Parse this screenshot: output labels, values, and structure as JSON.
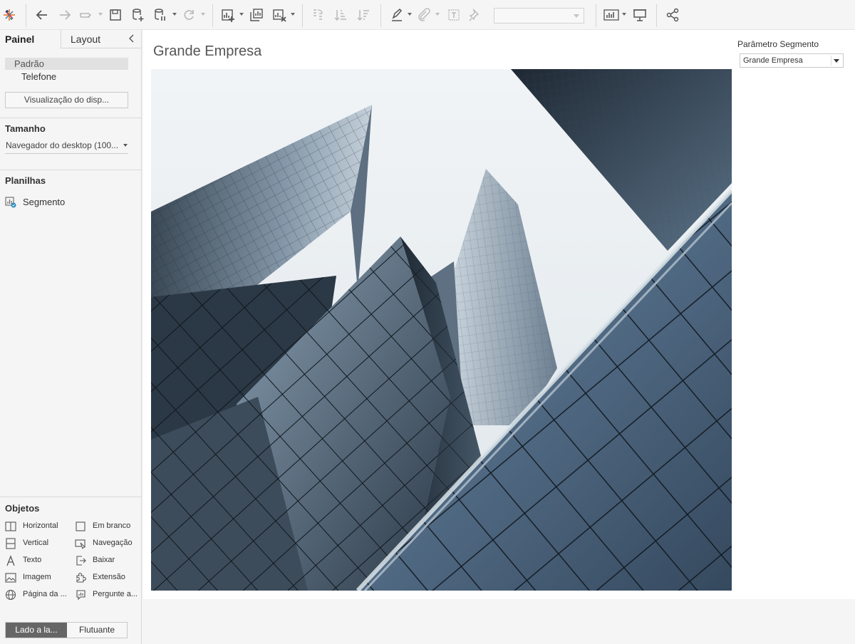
{
  "toolbar": {
    "icons": [
      "tableau-logo-icon",
      "undo-icon",
      "redo-icon",
      "replay-icon",
      "save-icon",
      "new-datasource-icon",
      "pause-updates-icon",
      "refresh-icon",
      "new-worksheet-icon",
      "duplicate-sheet-icon",
      "clear-sheet-icon",
      "swap-icon",
      "sort-ascending-icon",
      "sort-descending-icon",
      "highlight-icon",
      "group-icon",
      "labels-icon",
      "fix-axes-icon",
      "show-me-icon",
      "presentation-icon",
      "share-icon"
    ],
    "fit_dropdown_value": ""
  },
  "left_panel": {
    "tab_dashboard": "Painel",
    "tab_layout": "Layout",
    "devices": {
      "default": "Padrão",
      "phone": "Telefone"
    },
    "device_preview_button": "Visualização do disp...",
    "size": {
      "title": "Tamanho",
      "value": "Navegador do desktop (100..."
    },
    "sheets": {
      "title": "Planilhas",
      "items": [
        "Segmento"
      ]
    },
    "objects": {
      "title": "Objetos",
      "items": [
        {
          "label": "Horizontal",
          "icon": "horizontal-container-icon"
        },
        {
          "label": "Em branco",
          "icon": "blank-icon"
        },
        {
          "label": "Vertical",
          "icon": "vertical-container-icon"
        },
        {
          "label": "Navegação",
          "icon": "navigation-icon"
        },
        {
          "label": "Texto",
          "icon": "text-icon"
        },
        {
          "label": "Baixar",
          "icon": "download-icon"
        },
        {
          "label": "Imagem",
          "icon": "image-icon"
        },
        {
          "label": "Extensão",
          "icon": "extension-icon"
        },
        {
          "label": "Página da ...",
          "icon": "web-page-icon"
        },
        {
          "label": "Pergunte a...",
          "icon": "ask-data-icon"
        }
      ]
    },
    "layout_mode": {
      "tiled": "Lado a la...",
      "floating": "Flutuante"
    }
  },
  "dashboard": {
    "title": "Grande Empresa",
    "image_description_icon": "skyscrapers-image",
    "parameter": {
      "label": "Parâmetro Segmento",
      "value": "Grande Empresa"
    }
  },
  "colors": {
    "sky": "#e9eef2",
    "glass_dark": "#27333f",
    "glass_mid": "#6b7f92",
    "glass_light": "#a9b9c7",
    "tiled_active": "#666666"
  }
}
